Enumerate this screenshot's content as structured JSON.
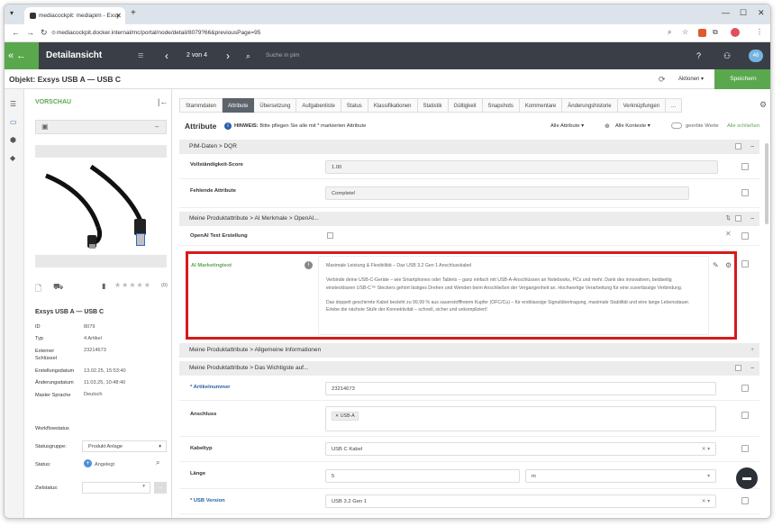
{
  "browser": {
    "tab_title": "mediacockpit: mediapim - Exsy",
    "tab_close": "✕",
    "new_tab": "+",
    "url": "mediacockpit.docker.internal/mc/portal/node/detail/8079?66&previousPage=95",
    "min": "—",
    "max": "☐",
    "close": "✕"
  },
  "header": {
    "back_chev": "«",
    "back_arrow": "←",
    "title": "Detailansicht",
    "menu": "≡",
    "prev": "‹",
    "pager": "2 von 4",
    "next": "›",
    "search_placeholder": "Suche in pim",
    "help": "?",
    "user": "⚇",
    "avatar": "46"
  },
  "objbar": {
    "title": "Objekt: Exsys USB A — USB C",
    "actions": "Aktionen",
    "save": "Speichern"
  },
  "preview": {
    "title": "VORSCHAU",
    "rating_count": "(0)",
    "product_name": "Exsys USB A — USB C",
    "meta": [
      {
        "label": "ID",
        "value": "8079"
      },
      {
        "label": "Typ",
        "value": "4 Artikel"
      },
      {
        "label": "Externer Schlüssel",
        "value": "23214673"
      },
      {
        "label": "Erstellungsdatum",
        "value": "13.02.25, 15:53:40"
      },
      {
        "label": "Änderungsdatum",
        "value": "11.03.25, 10:48:40"
      },
      {
        "label": "Master Sprache",
        "value": "Deutsch"
      }
    ],
    "workflow_title": "Workflowstatus",
    "status_group_label": "Statusgruppe:",
    "status_group_value": "Produkt Anlage",
    "status_label": "Status:",
    "status_value": "Angelegt",
    "target_label": "Zielstatus:"
  },
  "tabs": [
    "Stammdaten",
    "Attribute",
    "Übersetzung",
    "Aufgabenliste",
    "Status",
    "Klassifikationen",
    "Statistik",
    "Gültigkeit",
    "Snapshots",
    "Kommentare",
    "Änderungshistorie",
    "Verknüpfungen",
    "..."
  ],
  "attr": {
    "title": "Attribute",
    "hint_label": "HINWEIS:",
    "hint": "Bitte pflegen Sie alle mit * markierten Attribute",
    "filter_all": "Alle Attribute",
    "filter_context": "Alle Kontexte",
    "toggle": "geerbte Werte",
    "collapse": "Alle schließen"
  },
  "sections": {
    "pim": "PIM-Daten > DQR",
    "ai": "Meine Produktattribute > AI Merkmale > OpenAI...",
    "general": "Meine Produktattribute > Allgemeine Informationen",
    "important": "Meine Produktattribute > Das Wichtigste auf..."
  },
  "rows": {
    "score_label": "Vollständigkeit-Score",
    "score_value": "1.00",
    "missing_label": "Fehlende Attribute",
    "missing_value": "Complete!",
    "openai_label": "OpenAI Text Erstellung",
    "ai_label": "AI Marketingtext",
    "ai_text_1": "Maximale Leistung & Flexibilität – Das USB 3.2 Gen 1 Anschlusskabel",
    "ai_text_2": "Verbinde deine USB-C-Geräte – wie Smartphones oder Tablets – ganz einfach mit USB-A-Anschlüssen an Notebooks, PCs und mehr. Dank des innovativen, beidseitig einsteckbaren USB-C™ Steckers gehört lästiges Drehen und Wenden beim Anschließen der Vergangenheit an. Hochwertige Verarbeitung für eine zuverlässige Verbindung.",
    "ai_text_3": "Das doppelt geschirmte Kabel besteht zu 99,99 % aus sauerstofffreiem Kupfer (OFC/Cu) – für erstklassige Signalübertragung, maximale Stabilität und eine lange Lebensdauer. Erlebe die nächste Stufe der Konnektivität – schnell, sicher und unkompliziert!",
    "article_label": "* Artikelnummer",
    "article_value": "23214673",
    "connection_label": "Anschluss",
    "connection_tag": "USB-A",
    "cable_label": "Kabeltyp",
    "cable_value": "USB C Kabel",
    "length_label": "Länge",
    "length_value": "5",
    "length_unit": "m",
    "usb_label": "* USB Version",
    "usb_value": "USB 3.2 Gen 1"
  }
}
